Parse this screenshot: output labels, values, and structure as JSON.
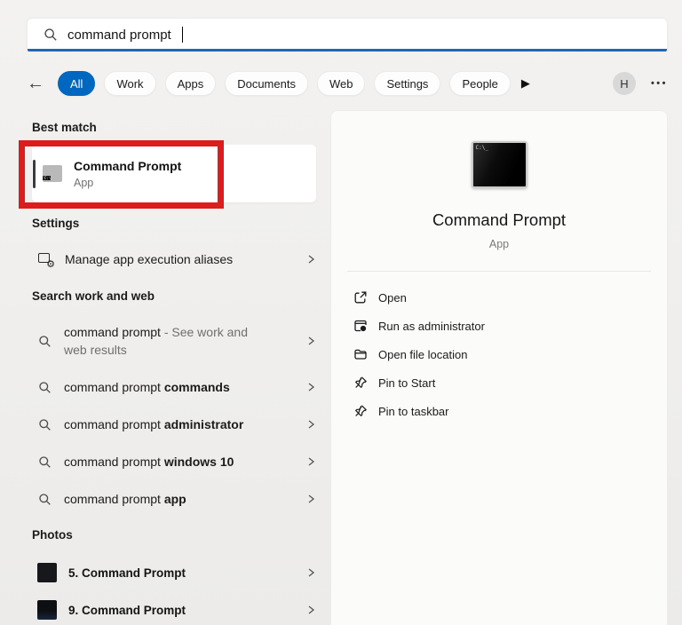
{
  "search": {
    "value": "command prompt"
  },
  "filters": {
    "back_arrow": "←",
    "tabs": [
      "All",
      "Work",
      "Apps",
      "Documents",
      "Web",
      "Settings",
      "People"
    ],
    "selected": "All",
    "more_triangle": "▶",
    "avatar_initial": "H",
    "ellipsis": "•••"
  },
  "left": {
    "best_match": {
      "header": "Best match",
      "item": {
        "title": "Command Prompt",
        "subtitle": "App"
      }
    },
    "settings": {
      "header": "Settings",
      "items": [
        {
          "label": "Manage app execution aliases"
        }
      ]
    },
    "web": {
      "header": "Search work and web",
      "items": [
        {
          "query": "command prompt",
          "gray_inline": " - See work and",
          "gray_line2": "web results"
        },
        {
          "prefix": "command prompt ",
          "bold": "commands"
        },
        {
          "prefix": "command prompt ",
          "bold": "administrator"
        },
        {
          "prefix": "command prompt ",
          "bold": "windows 10"
        },
        {
          "prefix": "command prompt ",
          "bold": "app"
        }
      ]
    },
    "photos": {
      "header": "Photos",
      "items": [
        {
          "label": "5. Command Prompt"
        },
        {
          "label": "9. Command Prompt"
        }
      ]
    }
  },
  "right": {
    "icon_text": "C:\\_",
    "icon_text_small": "C:\\",
    "title": "Command Prompt",
    "subtitle": "App",
    "actions": [
      {
        "label": "Open"
      },
      {
        "label": "Run as administrator"
      },
      {
        "label": "Open file location"
      },
      {
        "label": "Pin to Start"
      },
      {
        "label": "Pin to taskbar"
      }
    ]
  },
  "colors": {
    "accent": "#0067c0",
    "search_underline": "#2066b2",
    "annotation_red": "#dc1d1d"
  }
}
